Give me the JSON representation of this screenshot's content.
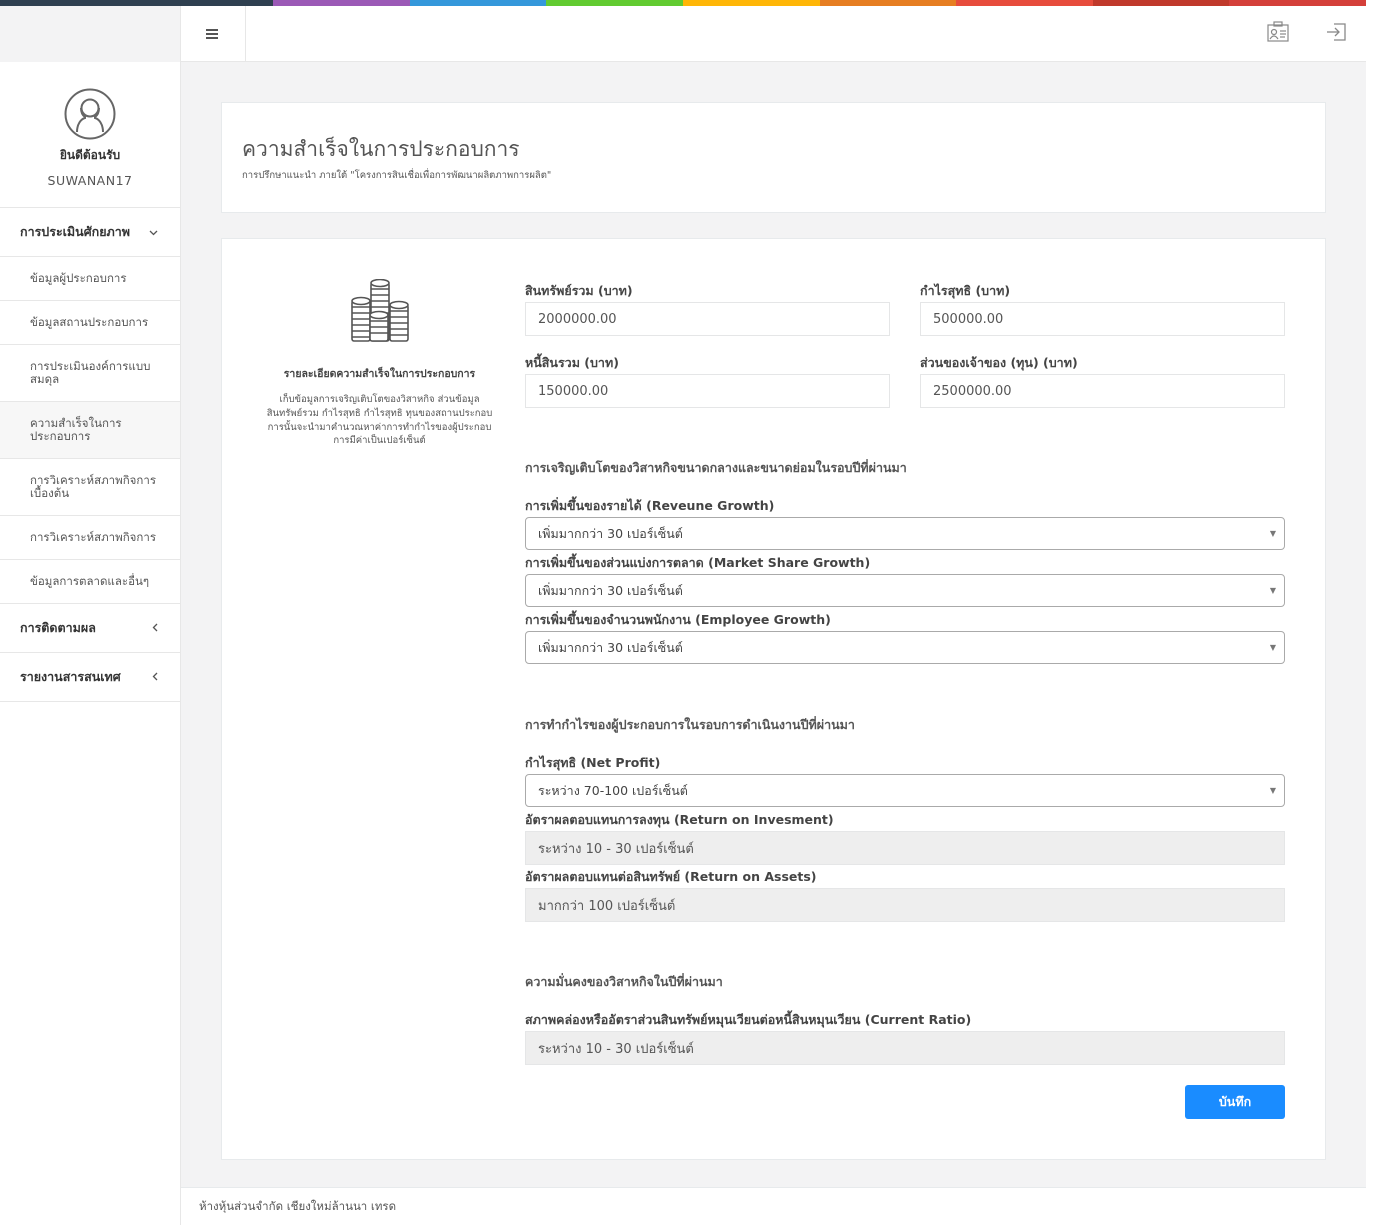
{
  "topbar_colors": [
    "#2f4050",
    "#2f4050",
    "#9b59b6",
    "#3498db",
    "#62cb31",
    "#ffb606",
    "#e67e22",
    "#e74c3c",
    "#c0392b",
    "#d43f3a"
  ],
  "header": {
    "menu_icon": "hamburger-icon",
    "profile_card_icon": "id-card-icon",
    "logout_icon": "sign-out-icon"
  },
  "sidebar": {
    "welcome": "ยินดีต้อนรับ",
    "username": "SUWANAN17",
    "group1": {
      "label": "การประเมินศักยภาพ",
      "chevron": "chevron-down-icon"
    },
    "items": [
      {
        "label": "ข้อมูลผู้ประกอบการ"
      },
      {
        "label": "ข้อมูลสถานประกอบการ"
      },
      {
        "label": "การประเมินองค์การแบบสมดุล"
      },
      {
        "label": "ความสำเร็จในการประกอบการ"
      },
      {
        "label": "การวิเคราะห์สภาพกิจการเบื้องต้น"
      },
      {
        "label": "การวิเคราะห์สภาพกิจการ"
      },
      {
        "label": "ข้อมูลการตลาดและอื่นๆ"
      }
    ],
    "group2": {
      "label": "การติดตามผล"
    },
    "group3": {
      "label": "รายงานสารสนเทศ"
    }
  },
  "page": {
    "title": "ความสำเร็จในการประกอบการ",
    "subtitle": "การปรึกษาแนะนำ ภายใต้ \"โครงการสินเชื่อเพื่อการพัฒนาผลิตภาพการผลิต\""
  },
  "description": {
    "icon": "coins-icon",
    "title": "รายละเอียดความสำเร็จในการประกอบการ",
    "text": "เก็บข้อมูลการเจริญเติบโตของวิสาหกิจ ส่วนข้อมูลสินทรัพย์รวม กำไรสุทธิ กำไรสุทธิ ทุนของสถานประกอบการนั้นจะนำมาคำนวณหาค่าการทำกำไรของผู้ประกอบการมีค่าเป็นเปอร์เซ็นต์"
  },
  "form": {
    "total_assets": {
      "label": "สินทรัพย์รวม (บาท)",
      "value": "2000000.00"
    },
    "net_profit_amount": {
      "label": "กำไรสุทธิ (บาท)",
      "value": "500000.00"
    },
    "total_liabilities": {
      "label": "หนี้สินรวม (บาท)",
      "value": "150000.00"
    },
    "equity": {
      "label": "ส่วนของเจ้าของ (ทุน) (บาท)",
      "value": "2500000.00"
    },
    "growth_section": "การเจริญเติบโตของวิสาหกิจขนาดกลางและขนาดย่อมในรอบปีที่ผ่านมา",
    "revenue_growth": {
      "label": "การเพิ่มขึ้นของรายได้ (Reveune Growth)",
      "value": "เพิ่มมากกว่า 30 เปอร์เซ็นต์"
    },
    "market_share_growth": {
      "label": "การเพิ่มขึ้นของส่วนแบ่งการตลาด (Market Share Growth)",
      "value": "เพิ่มมากกว่า 30 เปอร์เซ็นต์"
    },
    "employee_growth": {
      "label": "การเพิ่มขึ้นของจำนวนพนักงาน (Employee Growth)",
      "value": "เพิ่มมากกว่า 30 เปอร์เซ็นต์"
    },
    "profit_section": "การทำกำไรของผู้ประกอบการในรอบการดำเนินงานปีที่ผ่านมา",
    "net_profit": {
      "label": "กำไรสุทธิ (Net Profit)",
      "value": "ระหว่าง 70-100 เปอร์เซ็นต์"
    },
    "roi": {
      "label": "อัตราผลตอบแทนการลงทุน (Return on Invesment)",
      "value": "ระหว่าง 10 - 30 เปอร์เซ็นต์"
    },
    "roa": {
      "label": "อัตราผลตอบแทนต่อสินทรัพย์ (Return on Assets)",
      "value": "มากกว่า 100 เปอร์เซ็นต์"
    },
    "stability_section": "ความมั่นคงของวิสาหกิจในปีที่ผ่านมา",
    "current_ratio": {
      "label": "สภาพคล่องหรืออัตราส่วนสินทรัพย์หมุนเวียนต่อหนี้สินหมุนเวียน (Current Ratio)",
      "value": "ระหว่าง 10 - 30 เปอร์เซ็นต์"
    },
    "save_label": "บันทึก"
  },
  "footer": {
    "text": "ห้างหุ้นส่วนจำกัด เชียงใหม่ล้านนา เทรด"
  }
}
